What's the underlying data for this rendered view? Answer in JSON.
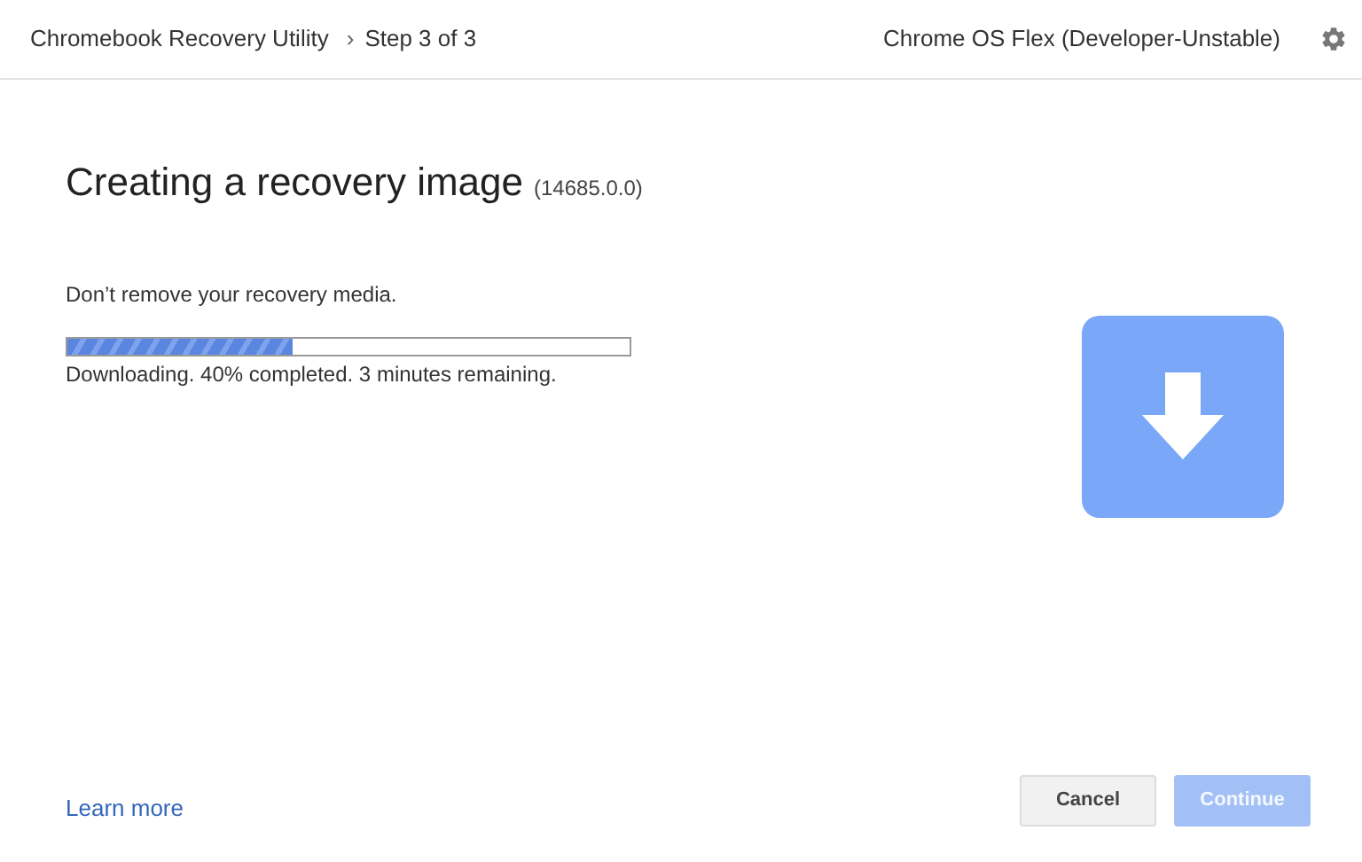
{
  "header": {
    "app_title": "Chromebook Recovery Utility",
    "separator": "›",
    "step": "Step 3 of 3",
    "product": "Chrome OS Flex (Developer-Unstable)"
  },
  "heading": {
    "title": "Creating a recovery image",
    "version": "(14685.0.0)"
  },
  "message": "Don’t remove your recovery media.",
  "progress": {
    "level": 0.4,
    "status": "Downloading. 40% completed. 3 minutes remaining."
  },
  "footer": {
    "link": "Learn more",
    "buttons": [
      {
        "label": "Cancel",
        "kind": "secondary",
        "disabled": false
      },
      {
        "label": "Continue",
        "kind": "primary",
        "disabled": true
      }
    ]
  }
}
